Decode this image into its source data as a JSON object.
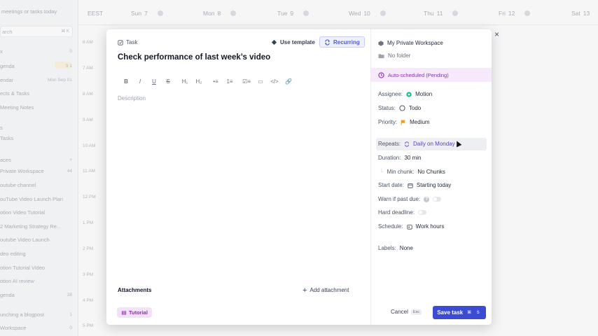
{
  "background": {
    "search_placeholder_top": "meetings or tasks today",
    "search_label": "arch",
    "search_shortcut": "⌘ K",
    "sidebar_items": [
      {
        "label": "x",
        "badge": "0"
      },
      {
        "label": "genda",
        "badge": "9 1"
      },
      {
        "label": "endar",
        "badge": "Mon Sep 01"
      },
      {
        "label": "ects & Tasks",
        "badge": ""
      },
      {
        "label": "Meeting Notes",
        "badge": ""
      },
      {
        "label": "s",
        "badge": ""
      },
      {
        "label": "Tasks",
        "badge": ""
      },
      {
        "label": "aces",
        "badge": "+"
      },
      {
        "label": "Private Workspace",
        "badge": "44"
      },
      {
        "label": "outube channel",
        "badge": ""
      },
      {
        "label": "ouTube Video Launch Plan",
        "badge": ""
      },
      {
        "label": "otion Video Tutorial",
        "badge": ""
      },
      {
        "label": "2 Marketing Strategy Re...",
        "badge": ""
      },
      {
        "label": "outube Video Launch",
        "badge": ""
      },
      {
        "label": "deo editing",
        "badge": ""
      },
      {
        "label": "otion Tutorial Video",
        "badge": ""
      },
      {
        "label": "otion AI review",
        "badge": ""
      },
      {
        "label": "genda",
        "badge": "38"
      },
      {
        "label": "unching a blogpost",
        "badge": "1"
      },
      {
        "label": "Workspace",
        "badge": "0"
      }
    ],
    "timezone": "EEST",
    "days": [
      {
        "name": "Sun",
        "num": "7"
      },
      {
        "name": "Mon",
        "num": "8"
      },
      {
        "name": "Tue",
        "num": "9"
      },
      {
        "name": "Wed",
        "num": "10"
      },
      {
        "name": "Thu",
        "num": "11"
      },
      {
        "name": "Fri",
        "num": "12"
      },
      {
        "name": "Sat",
        "num": "13"
      }
    ],
    "hours": [
      "8 AM",
      "7 AM",
      "8 AM",
      "9 AM",
      "10 AM",
      "11 AM",
      "12 PM",
      "1 PM",
      "2 PM",
      "3 PM",
      "4 PM",
      "5 PM"
    ]
  },
  "task": {
    "type_label": "Task",
    "use_template": "Use template",
    "recurring": "Recurring",
    "title": "Check performance of last week’s video",
    "description_placeholder": "Description",
    "toolbar": [
      "B",
      "I",
      "U",
      "S",
      "H₁",
      "H₂",
      "•≡",
      "1≡",
      "☑≡",
      "▭",
      "</>",
      "🔗"
    ],
    "attachments_label": "Attachments",
    "add_attachment": "Add attachment",
    "tag": "Tutorial"
  },
  "panel": {
    "workspace": "My Private Workspace",
    "folder": "No folder",
    "auto_scheduled": "Auto-scheduled (Pending)",
    "assignee_label": "Assignee:",
    "assignee": "Motion",
    "status_label": "Status:",
    "status": "Todo",
    "priority_label": "Priority:",
    "priority": "Medium",
    "repeats_label": "Repeats:",
    "repeats": "Daily on Monday",
    "duration_label": "Duration:",
    "duration": "30 min",
    "min_chunk_label": "Min chunk:",
    "min_chunk": "No Chunks",
    "start_date_label": "Start date:",
    "start_date": "Starting today",
    "warn_label": "Warn if past due:",
    "hard_deadline_label": "Hard deadline:",
    "schedule_label": "Schedule:",
    "schedule": "Work hours",
    "labels_label": "Labels:",
    "labels": "None",
    "cancel": "Cancel",
    "cancel_shortcut": "Esc",
    "save": "Save task",
    "save_shortcut": "⌘ S"
  },
  "colors": {
    "accent": "#3b4bd2",
    "auto_scheduled": "#8b2fb0",
    "priority_flag": "#f59e0b",
    "assignee_dot": "#10b981",
    "recurring_text": "#4f5bd5"
  }
}
